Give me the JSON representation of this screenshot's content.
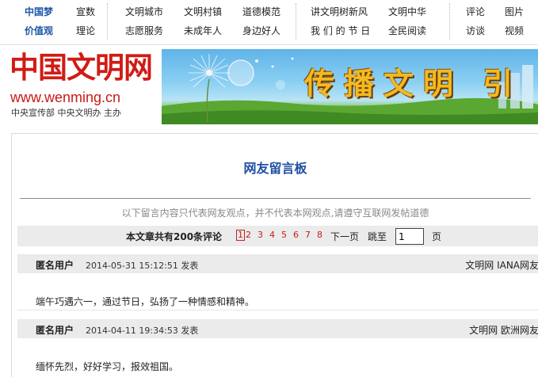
{
  "topnav": {
    "row1": [
      "中国梦",
      "宣数",
      "文明城市",
      "文明村镇",
      "道德模范",
      "讲文明树新风",
      "文明中华",
      "评论",
      "图片"
    ],
    "row2": [
      "价值观",
      "理论",
      "志愿服务",
      "未成年人",
      "身边好人",
      "我 们 的 节 日",
      "全民阅读",
      "访谈",
      "视频"
    ]
  },
  "header": {
    "logo_cn": "中国文明网",
    "logo_url": "www.wenming.cn",
    "logo_sub": "中央宣传部  中央文明办  主办",
    "banner_text": "传播文明 引"
  },
  "board": {
    "title": "网友留言板",
    "notice": "以下留言内容只代表网友观点，并不代表本网观点,请遵守互联网发帖道德"
  },
  "pager": {
    "count_text": "本文章共有200条评论",
    "pages": [
      "1",
      "2",
      "3",
      "4",
      "5",
      "6",
      "7",
      "8"
    ],
    "current_page": "1",
    "next_label": "下一页",
    "goto_label": "跳至",
    "page_input_value": "1",
    "page_unit": "页"
  },
  "comments": [
    {
      "user": "匿名用户",
      "time": "2014-05-31 15:12:51 发表",
      "source": "文明网 IANA网友",
      "text": "端午巧遇六一，通过节日，弘扬了一种情感和精神。"
    },
    {
      "user": "匿名用户",
      "time": "2014-04-11 19:34:53 发表",
      "source": "文明网 欧洲网友",
      "text": "缅怀先烈，好好学习，报效祖国。"
    }
  ],
  "colors": {
    "nav_blue": "#1d56a8",
    "logo_red": "#d01c15",
    "title_blue": "#1f4fa3",
    "page_red": "#c71d1d",
    "banner_text": "#f2ba21"
  }
}
